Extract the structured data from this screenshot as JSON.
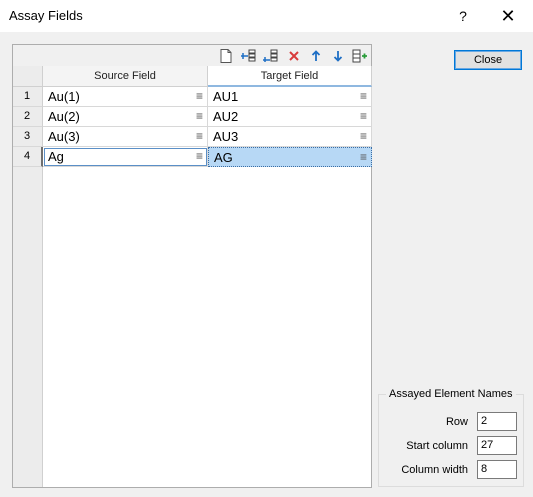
{
  "window": {
    "title": "Assay Fields",
    "help_glyph": "?",
    "close_glyph": "✕"
  },
  "toolbar": {
    "icons": [
      "new-icon",
      "insert-row-icon",
      "append-row-icon",
      "delete-icon",
      "move-up-icon",
      "move-down-icon",
      "add-column-icon"
    ]
  },
  "grid": {
    "columns": [
      "Source Field",
      "Target Field"
    ],
    "rows": [
      {
        "num": "1",
        "source": "Au(1)",
        "target": "AU1"
      },
      {
        "num": "2",
        "source": "Au(2)",
        "target": "AU2"
      },
      {
        "num": "3",
        "source": "Au(3)",
        "target": "AU3"
      },
      {
        "num": "4",
        "source": "Ag",
        "target": "AG"
      }
    ],
    "menu_glyph": "≡"
  },
  "buttons": {
    "close_label": "Close"
  },
  "assayed": {
    "title": "Assayed Element Names",
    "row_label": "Row",
    "row_value": "2",
    "start_column_label": "Start column",
    "start_column_value": "27",
    "column_width_label": "Column width",
    "column_width_value": "8"
  },
  "colors": {
    "accent": "#0078d7",
    "selection": "#b7d8f5",
    "delete_icon": "#d83b3b",
    "arrow_icon": "#1e6fc5",
    "add_icon": "#2a9d3a"
  }
}
